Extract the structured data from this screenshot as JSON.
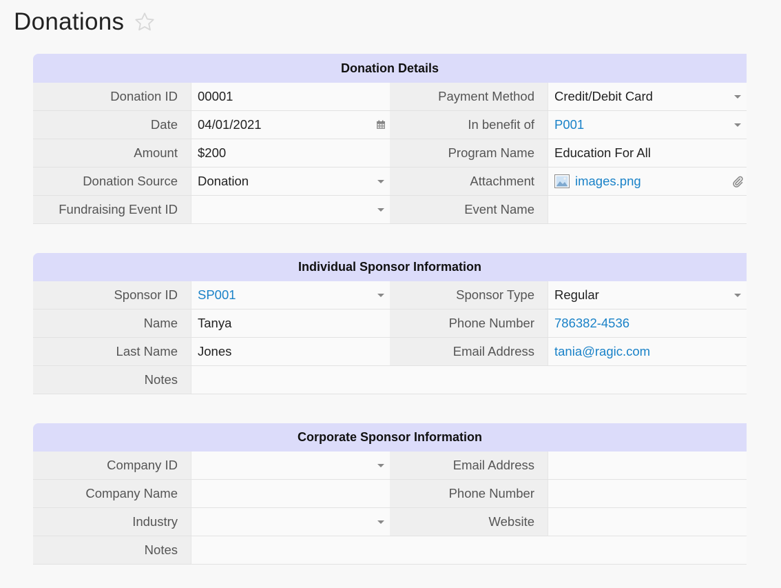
{
  "page": {
    "title": "Donations"
  },
  "donation_details": {
    "header": "Donation Details",
    "donation_id": {
      "label": "Donation ID",
      "value": "00001"
    },
    "payment_method": {
      "label": "Payment Method",
      "value": "Credit/Debit Card"
    },
    "date": {
      "label": "Date",
      "value": "04/01/2021"
    },
    "in_benefit_of": {
      "label": "In benefit of",
      "value": "P001"
    },
    "amount": {
      "label": "Amount",
      "value": "$200"
    },
    "program_name": {
      "label": "Program Name",
      "value": "Education For All"
    },
    "donation_source": {
      "label": "Donation Source",
      "value": "Donation"
    },
    "attachment": {
      "label": "Attachment",
      "value": "images.png"
    },
    "fundraising_event_id": {
      "label": "Fundraising Event ID",
      "value": ""
    },
    "event_name": {
      "label": "Event Name",
      "value": ""
    }
  },
  "individual_sponsor": {
    "header": "Individual Sponsor Information",
    "sponsor_id": {
      "label": "Sponsor ID",
      "value": "SP001"
    },
    "sponsor_type": {
      "label": "Sponsor Type",
      "value": "Regular"
    },
    "name": {
      "label": "Name",
      "value": "Tanya"
    },
    "phone_number": {
      "label": "Phone Number",
      "value": "786382-4536"
    },
    "last_name": {
      "label": "Last Name",
      "value": "Jones"
    },
    "email_address": {
      "label": "Email Address",
      "value": "tania@ragic.com"
    },
    "notes": {
      "label": "Notes",
      "value": ""
    }
  },
  "corporate_sponsor": {
    "header": "Corporate Sponsor Information",
    "company_id": {
      "label": "Company ID",
      "value": ""
    },
    "email_address": {
      "label": "Email Address",
      "value": ""
    },
    "company_name": {
      "label": "Company Name",
      "value": ""
    },
    "phone_number": {
      "label": "Phone Number",
      "value": ""
    },
    "industry": {
      "label": "Industry",
      "value": ""
    },
    "website": {
      "label": "Website",
      "value": ""
    },
    "notes": {
      "label": "Notes",
      "value": ""
    }
  },
  "colors": {
    "header_bg": "#dcdcfa",
    "link": "#1a82c8",
    "label_bg": "#efefef"
  },
  "icons": [
    "star-outline-icon",
    "calendar-icon",
    "dropdown-caret-icon",
    "paperclip-icon",
    "image-file-icon"
  ]
}
